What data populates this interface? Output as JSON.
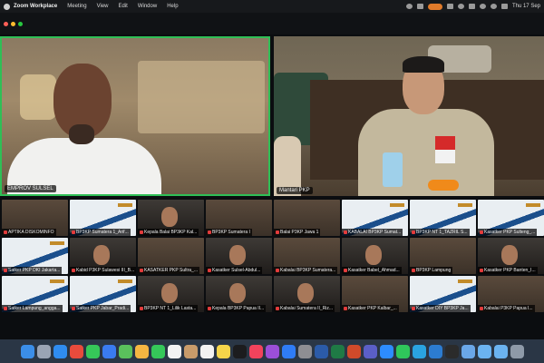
{
  "menubar": {
    "app_name": "Zoom Workplace",
    "menus": [
      "Meeting",
      "View",
      "Edit",
      "Window",
      "Help"
    ],
    "clock": "Thu 17 Sep"
  },
  "speakers": [
    {
      "name": "EMPROV SULSEL"
    },
    {
      "name": "Mantari PKP"
    }
  ],
  "gallery": [
    {
      "name": "APTIKA DISKOMINFO",
      "muted": true
    },
    {
      "name": "BP3KP Sumatera 1_Arif...",
      "muted": true
    },
    {
      "name": "Kepala Balai BP3KP Kal...",
      "muted": true
    },
    {
      "name": "BP3KP Sumatera I",
      "muted": true
    },
    {
      "name": "Balai P3KP Jawa 1",
      "muted": true
    },
    {
      "name": "KABALAI BP3KP Sumat...",
      "muted": true
    },
    {
      "name": "BP3KP NT 1_TAZRIL S...",
      "muted": true
    },
    {
      "name": "Kasatker PKP Sulteng_...",
      "muted": true
    },
    {
      "name": "Satker PKP DKI Jakarta...",
      "muted": true
    },
    {
      "name": "Kabid P3KP Sulawesi III_B...",
      "muted": true
    },
    {
      "name": "KASATKER PKP Sultra_...",
      "muted": true
    },
    {
      "name": "Kasatker Sulsel-Abdul...",
      "muted": true
    },
    {
      "name": "Kabalai BP3KP Sumatera...",
      "muted": true
    },
    {
      "name": "Kasatker Babel_Ahmad...",
      "muted": true
    },
    {
      "name": "BP3KP Lampung",
      "muted": true
    },
    {
      "name": "Kasatker PKP Banten_I...",
      "muted": true
    },
    {
      "name": "Satker Lampung_angga...",
      "muted": true
    },
    {
      "name": "Satker PKP Jabar_Pradi...",
      "muted": true
    },
    {
      "name": "BP3KP NT 1_Lilik Lasta...",
      "muted": true
    },
    {
      "name": "Kepala BP3KP Papua II...",
      "muted": true
    },
    {
      "name": "Kabalai Sumatera II_Riz...",
      "muted": true
    },
    {
      "name": "Kasatker PKP Kalbar_...",
      "muted": true
    },
    {
      "name": "Kasatker DIY BP3KP Ja...",
      "muted": true
    },
    {
      "name": "Kabalai P3KP Papua I...",
      "muted": true
    }
  ],
  "dock_icons": [
    "finder-icon",
    "launchpad-icon",
    "safari-icon",
    "chrome-icon",
    "messages-icon",
    "mail-icon",
    "maps-icon",
    "photos-icon",
    "facetime-icon",
    "calendar-icon",
    "contacts-icon",
    "reminders-icon",
    "notes-icon",
    "tv-icon",
    "music-icon",
    "podcasts-icon",
    "appstore-icon",
    "settings-icon",
    "word-icon",
    "excel-icon",
    "powerpoint-icon",
    "teams-icon",
    "zoom-icon",
    "whatsapp-icon",
    "telegram-icon",
    "vscode-icon",
    "terminal-icon",
    "preview-icon",
    "folder-icon",
    "downloads-icon",
    "trash-icon"
  ],
  "dock_colors": [
    "#3b8ee8",
    "#9aa4b4",
    "#2f8cf0",
    "#e84b3c",
    "#36c759",
    "#3a7bf0",
    "#5ac05c",
    "#f5b642",
    "#35c759",
    "#f2f2f2",
    "#c89b6a",
    "#f2f2f2",
    "#f5d54a",
    "#1c1c1e",
    "#f2435c",
    "#9b4fd8",
    "#2f7cf6",
    "#8e8e93",
    "#2b5ba8",
    "#1f7a45",
    "#d04a2a",
    "#5b5fc7",
    "#2d8cff",
    "#2fc65b",
    "#2aa3e0",
    "#2c7cd1",
    "#2b2b2b",
    "#6aa7e8",
    "#6bb3f0",
    "#6bb3f0",
    "#8e9aa8"
  ]
}
